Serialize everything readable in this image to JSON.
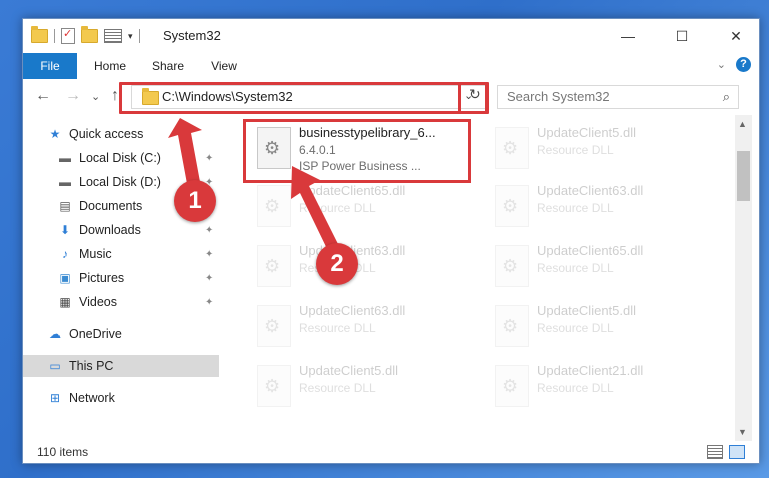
{
  "window": {
    "title": "System32",
    "minimize_glyph": "—",
    "maximize_glyph": "☐",
    "close_glyph": "✕"
  },
  "ribbon": {
    "tabs": [
      "File",
      "Home",
      "Share",
      "View"
    ],
    "help_glyph": "?",
    "collapse_glyph": "⌄"
  },
  "address": {
    "path": "C:\\Windows\\System32",
    "back_glyph": "←",
    "forward_glyph": "→",
    "recent_glyph": "⌄",
    "up_glyph": "↑",
    "dropdown_glyph": "⌄",
    "refresh_glyph": "↻"
  },
  "search": {
    "placeholder": "Search System32",
    "icon_glyph": "⌕"
  },
  "sidebar": {
    "items": [
      {
        "label": "Quick access",
        "icon": "star-icon",
        "glyph": "★",
        "pinned": false
      },
      {
        "label": "Local Disk (C:)",
        "icon": "drive-icon",
        "glyph": "▬",
        "pinned": true
      },
      {
        "label": "Local Disk (D:)",
        "icon": "drive-icon",
        "glyph": "▬",
        "pinned": true
      },
      {
        "label": "Documents",
        "icon": "documents-icon",
        "glyph": "▤",
        "pinned": true
      },
      {
        "label": "Downloads",
        "icon": "download-icon",
        "glyph": "⬇",
        "pinned": true
      },
      {
        "label": "Music",
        "icon": "music-icon",
        "glyph": "♪",
        "pinned": true
      },
      {
        "label": "Pictures",
        "icon": "pictures-icon",
        "glyph": "▣",
        "pinned": true
      },
      {
        "label": "Videos",
        "icon": "videos-icon",
        "glyph": "▦",
        "pinned": true
      },
      {
        "label": "OneDrive",
        "icon": "cloud-icon",
        "glyph": "☁",
        "pinned": false
      },
      {
        "label": "This PC",
        "icon": "computer-icon",
        "glyph": "▭",
        "pinned": false
      },
      {
        "label": "Network",
        "icon": "network-icon",
        "glyph": "⊞",
        "pinned": false
      }
    ],
    "pin_glyph": "✦"
  },
  "files": [
    {
      "name": "businesstypelibrary_6...",
      "line2": "6.4.0.1",
      "line3": "ISP Power Business ..."
    },
    {
      "name": "UpdateClient5.dll",
      "line2": "Resource DLL"
    },
    {
      "name": "UpdateClient65.dll",
      "line2": "Resource DLL"
    },
    {
      "name": "UpdateClient63.dll",
      "line2": "Resource DLL"
    },
    {
      "name": "UpdateClient63.dll",
      "line2": "Resource DLL"
    },
    {
      "name": "UpdateClient65.dll",
      "line2": "Resource DLL"
    },
    {
      "name": "UpdateClient63.dll",
      "line2": "Resource DLL"
    },
    {
      "name": "UpdateClient5.dll",
      "line2": "Resource DLL"
    },
    {
      "name": "UpdateClient5.dll",
      "line2": "Resource DLL"
    },
    {
      "name": "UpdateClient21.dll",
      "line2": "Resource DLL"
    }
  ],
  "status": {
    "item_count": "110 items"
  },
  "annotations": {
    "step1": "1",
    "step2": "2",
    "color": "#d9393b"
  }
}
